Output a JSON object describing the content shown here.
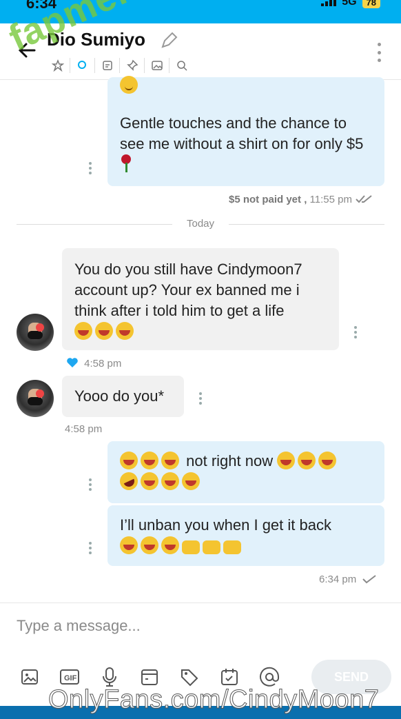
{
  "status_bar": {
    "time": "6:34",
    "network": "5G",
    "battery": "78"
  },
  "header": {
    "contact_name": "Dio Sumiyo"
  },
  "watermark_top": "fapmenu.com",
  "watermark_bottom": "OnlyFans.com/CindyMoon7",
  "messages": {
    "m1": {
      "text": "Gentle touches and the chance to see me without a shirt on for only $5",
      "price_status": "$5 not paid yet ,",
      "time": "11:55 pm"
    },
    "date_divider": "Today",
    "m2": {
      "text": "You do you still have Cindymoon7 account up? Your ex banned me i think after i told him to get a life",
      "time": "4:58 pm"
    },
    "m3": {
      "text": "Yooo do you*",
      "time": "4:58 pm"
    },
    "m4": {
      "text": "not right now"
    },
    "m5": {
      "text": "I’ll unban you when I get it back",
      "time": "6:34 pm"
    }
  },
  "input": {
    "placeholder": "Type a message...",
    "send_label": "SEND"
  },
  "icons": [
    "back-arrow-icon",
    "edit-pencil-icon",
    "star-icon",
    "tag-icon",
    "note-icon",
    "pin-icon",
    "image-icon",
    "search-icon",
    "more-vertical-icon",
    "gif-icon",
    "microphone-icon",
    "calendar-icon",
    "price-tag-icon",
    "schedule-icon",
    "mention-icon",
    "heart-icon",
    "double-check-icon",
    "check-icon"
  ],
  "colors": {
    "brand": "#00aff0",
    "outgoing_bubble": "#e1f1fb",
    "incoming_bubble": "#f1f1f1",
    "like_heart": "#1ea7f0"
  }
}
